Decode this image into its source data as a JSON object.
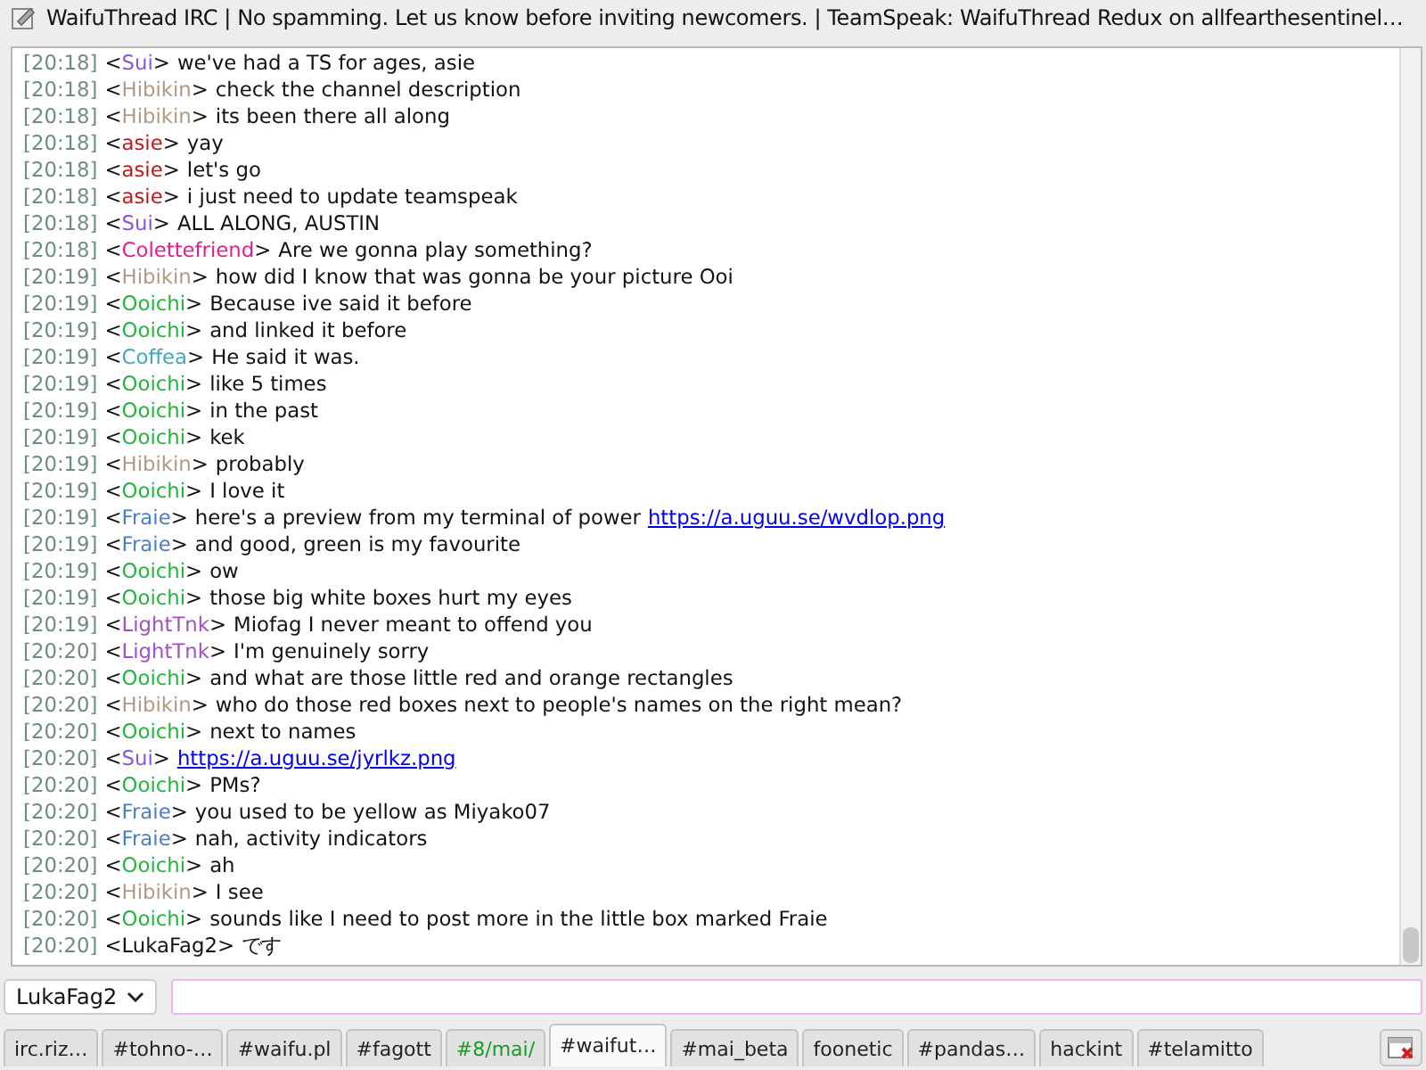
{
  "window": {
    "title": "WaifuThread IRC | No spamming. Let us know before inviting newcomers. | TeamSpeak: WaifuThread Redux on allfearthesentinel…"
  },
  "messages": [
    {
      "time": "[20:18]",
      "nick": "<Sui>",
      "color": "#8a55e0",
      "text": "we've had a TS for ages, asie"
    },
    {
      "time": "[20:18]",
      "nick": "<Hibikin>",
      "color": "#b09a84",
      "text": "check the channel description"
    },
    {
      "time": "[20:18]",
      "nick": "<Hibikin>",
      "color": "#b09a84",
      "text": "its been there all along"
    },
    {
      "time": "[20:18]",
      "nick": "<asie>",
      "color": "#c01818",
      "text": "yay"
    },
    {
      "time": "[20:18]",
      "nick": "<asie>",
      "color": "#c01818",
      "text": "let's go"
    },
    {
      "time": "[20:18]",
      "nick": "<asie>",
      "color": "#c01818",
      "text": "i just need to update teamspeak"
    },
    {
      "time": "[20:18]",
      "nick": "<Sui>",
      "color": "#8a55e0",
      "text": "ALL ALONG, AUSTIN"
    },
    {
      "time": "[20:18]",
      "nick": "<Colettefriend>",
      "color": "#e0208c",
      "text": "Are we gonna play something?"
    },
    {
      "time": "[20:19]",
      "nick": "<Hibikin>",
      "color": "#b09a84",
      "text": "how did I know that was gonna be your picture Ooi"
    },
    {
      "time": "[20:19]",
      "nick": "<Ooichi>",
      "color": "#22b43c",
      "text": "Because ive said it before"
    },
    {
      "time": "[20:19]",
      "nick": "<Ooichi>",
      "color": "#22b43c",
      "text": "and linked it before"
    },
    {
      "time": "[20:19]",
      "nick": "<Coffea>",
      "color": "#40a8b8",
      "text": "He said it was."
    },
    {
      "time": "[20:19]",
      "nick": "<Ooichi>",
      "color": "#22b43c",
      "text": "like 5 times"
    },
    {
      "time": "[20:19]",
      "nick": "<Ooichi>",
      "color": "#22b43c",
      "text": "in the past"
    },
    {
      "time": "[20:19]",
      "nick": "<Ooichi>",
      "color": "#22b43c",
      "text": "kek"
    },
    {
      "time": "[20:19]",
      "nick": "<Hibikin>",
      "color": "#b09a84",
      "text": "probably"
    },
    {
      "time": "[20:19]",
      "nick": "<Ooichi>",
      "color": "#22b43c",
      "text": "I love it"
    },
    {
      "time": "[20:19]",
      "nick": "<Fraie>",
      "color": "#4a7ec8",
      "text": "here's a preview from my terminal of power",
      "link": "https://a.uguu.se/wvdlop.png"
    },
    {
      "time": "[20:19]",
      "nick": "<Fraie>",
      "color": "#4a7ec8",
      "text": "and good, green is my favourite"
    },
    {
      "time": "[20:19]",
      "nick": "<Ooichi>",
      "color": "#22b43c",
      "text": "ow"
    },
    {
      "time": "[20:19]",
      "nick": "<Ooichi>",
      "color": "#22b43c",
      "text": "those big white boxes hurt my eyes"
    },
    {
      "time": "[20:19]",
      "nick": "<LightTnk>",
      "color": "#a050c8",
      "text": "Miofag I never meant to offend you"
    },
    {
      "time": "[20:20]",
      "nick": "<LightTnk>",
      "color": "#a050c8",
      "text": "I'm genuinely sorry"
    },
    {
      "time": "[20:20]",
      "nick": "<Ooichi>",
      "color": "#22b43c",
      "text": "and what are those little red and orange rectangles"
    },
    {
      "time": "[20:20]",
      "nick": "<Hibikin>",
      "color": "#b09a84",
      "text": "who do those red boxes next to people's names on the right mean?"
    },
    {
      "time": "[20:20]",
      "nick": "<Ooichi>",
      "color": "#22b43c",
      "text": "next to names"
    },
    {
      "time": "[20:20]",
      "nick": "<Sui>",
      "color": "#8a55e0",
      "link": "https://a.uguu.se/jyrlkz.png"
    },
    {
      "time": "[20:20]",
      "nick": "<Ooichi>",
      "color": "#22b43c",
      "text": "PMs?"
    },
    {
      "time": "[20:20]",
      "nick": "<Fraie>",
      "color": "#4a7ec8",
      "text": "you used to be yellow as Miyako07"
    },
    {
      "time": "[20:20]",
      "nick": "<Fraie>",
      "color": "#4a7ec8",
      "text": "nah, activity indicators"
    },
    {
      "time": "[20:20]",
      "nick": "<Ooichi>",
      "color": "#22b43c",
      "text": "ah"
    },
    {
      "time": "[20:20]",
      "nick": "<Hibikin>",
      "color": "#b09a84",
      "text": "I see"
    },
    {
      "time": "[20:20]",
      "nick": "<Ooichi>",
      "color": "#22b43c",
      "text": "sounds like I need to post more in the little box marked Fraie"
    },
    {
      "time": "[20:20]",
      "nick": "<LukaFag2>",
      "text": "です"
    }
  ],
  "input": {
    "nick": "LukaFag2"
  },
  "tabs": [
    {
      "label": "irc.riz…",
      "selected": false,
      "activity": false
    },
    {
      "label": "#tohno-…",
      "selected": false,
      "activity": false
    },
    {
      "label": "#waifu.pl",
      "selected": false,
      "activity": false
    },
    {
      "label": "#fagott",
      "selected": false,
      "activity": false
    },
    {
      "label": "#8/mai/",
      "selected": false,
      "activity": true
    },
    {
      "label": "#waifut…",
      "selected": true,
      "activity": false
    },
    {
      "label": "#mai_beta",
      "selected": false,
      "activity": false
    },
    {
      "label": "foonetic",
      "selected": false,
      "activity": false
    },
    {
      "label": "#pandas…",
      "selected": false,
      "activity": false
    },
    {
      "label": "hackint",
      "selected": false,
      "activity": false
    },
    {
      "label": "#telamitto",
      "selected": false,
      "activity": false
    }
  ]
}
